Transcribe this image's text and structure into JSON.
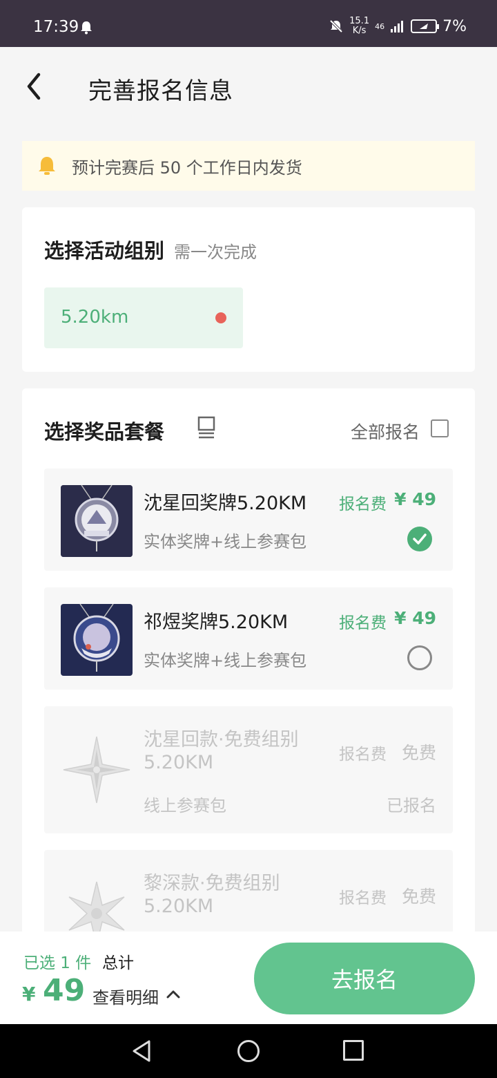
{
  "status_bar": {
    "time": "17:39",
    "net_speed_value": "15.1",
    "net_speed_unit": "K/s",
    "network": "46",
    "battery": "7%"
  },
  "header": {
    "title": "完善报名信息"
  },
  "notice": {
    "text": "预计完赛后 50 个工作日内发货"
  },
  "group_section": {
    "title": "选择活动组别",
    "subtitle": "需一次完成",
    "options": [
      {
        "label": "5.20km",
        "selected": true
      }
    ]
  },
  "prize_section": {
    "title": "选择奖品套餐",
    "select_all_label": "全部报名",
    "items": [
      {
        "name": "沈星回奖牌5.20KM",
        "desc": "实体奖牌+线上参赛包",
        "fee_label": "报名费",
        "price": "¥ 49",
        "state": "checked"
      },
      {
        "name": "祁煜奖牌5.20KM",
        "desc": "实体奖牌+线上参赛包",
        "fee_label": "报名费",
        "price": "¥ 49",
        "state": "unchecked"
      },
      {
        "name_line1": "沈星回款·免费组别",
        "name_line2": "5.20KM",
        "desc": "线上参赛包",
        "fee_label": "报名费",
        "price": "免费",
        "status": "已报名"
      },
      {
        "name_line1": "黎深款·免费组别",
        "name_line2": "5.20KM",
        "fee_label": "报名费",
        "price": "免费"
      }
    ]
  },
  "bottom_bar": {
    "selected_text": "已选 1 件",
    "total_label": "总计",
    "currency": "¥",
    "total": "49",
    "detail_label": "查看明细",
    "submit_label": "去报名"
  },
  "colors": {
    "accent": "#4caf78",
    "button": "#62c48f",
    "notice_bg": "#fffbea",
    "status_bar": "#3b3342",
    "dot": "#e8635a"
  }
}
